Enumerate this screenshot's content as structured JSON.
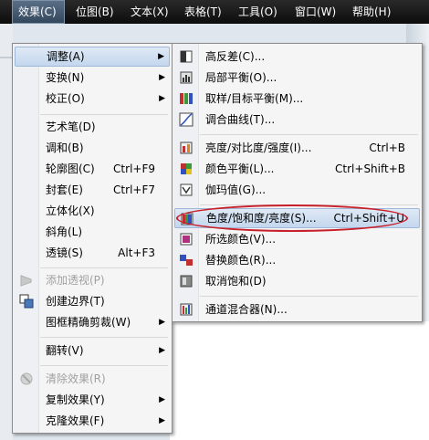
{
  "menubar": {
    "items": [
      {
        "label": "效果(C)"
      },
      {
        "label": "位图(B)"
      },
      {
        "label": "文本(X)"
      },
      {
        "label": "表格(T)"
      },
      {
        "label": "工具(O)"
      },
      {
        "label": "窗口(W)"
      },
      {
        "label": "帮助(H)"
      }
    ]
  },
  "effects_menu": {
    "items": [
      {
        "label": "调整(A)",
        "shortcut": "",
        "submenu": true
      },
      {
        "label": "变换(N)",
        "shortcut": "",
        "submenu": true
      },
      {
        "label": "校正(O)",
        "shortcut": "",
        "submenu": true
      },
      {
        "label": "艺术笔(D)",
        "shortcut": ""
      },
      {
        "label": "调和(B)",
        "shortcut": ""
      },
      {
        "label": "轮廓图(C)",
        "shortcut": "Ctrl+F9"
      },
      {
        "label": "封套(E)",
        "shortcut": "Ctrl+F7"
      },
      {
        "label": "立体化(X)",
        "shortcut": ""
      },
      {
        "label": "斜角(L)",
        "shortcut": ""
      },
      {
        "label": "透镜(S)",
        "shortcut": "Alt+F3"
      },
      {
        "label": "添加透视(P)",
        "shortcut": "",
        "disabled": true
      },
      {
        "label": "创建边界(T)",
        "shortcut": ""
      },
      {
        "label": "图框精确剪裁(W)",
        "shortcut": "",
        "submenu": true
      },
      {
        "label": "翻转(V)",
        "shortcut": "",
        "submenu": true
      },
      {
        "label": "清除效果(R)",
        "shortcut": "",
        "disabled": true
      },
      {
        "label": "复制效果(Y)",
        "shortcut": "",
        "submenu": true
      },
      {
        "label": "克隆效果(F)",
        "shortcut": "",
        "submenu": true
      }
    ]
  },
  "adjust_submenu": {
    "items": [
      {
        "label": "高反差(C)...",
        "shortcut": ""
      },
      {
        "label": "局部平衡(O)...",
        "shortcut": ""
      },
      {
        "label": "取样/目标平衡(M)...",
        "shortcut": ""
      },
      {
        "label": "调合曲线(T)...",
        "shortcut": ""
      },
      {
        "label": "亮度/对比度/强度(I)...",
        "shortcut": "Ctrl+B"
      },
      {
        "label": "颜色平衡(L)...",
        "shortcut": "Ctrl+Shift+B"
      },
      {
        "label": "伽玛值(G)...",
        "shortcut": ""
      },
      {
        "label": "色度/饱和度/亮度(S)...",
        "shortcut": "Ctrl+Shift+U"
      },
      {
        "label": "所选颜色(V)...",
        "shortcut": ""
      },
      {
        "label": "替换颜色(R)...",
        "shortcut": ""
      },
      {
        "label": "取消饱和(D)",
        "shortcut": ""
      },
      {
        "label": "通道混合器(N)...",
        "shortcut": ""
      }
    ]
  },
  "colors": {
    "menubar_bg": "#111111",
    "highlight": "#c4d7ee",
    "annotation": "#c8202a",
    "disabled_text": "#a0a0a0"
  }
}
